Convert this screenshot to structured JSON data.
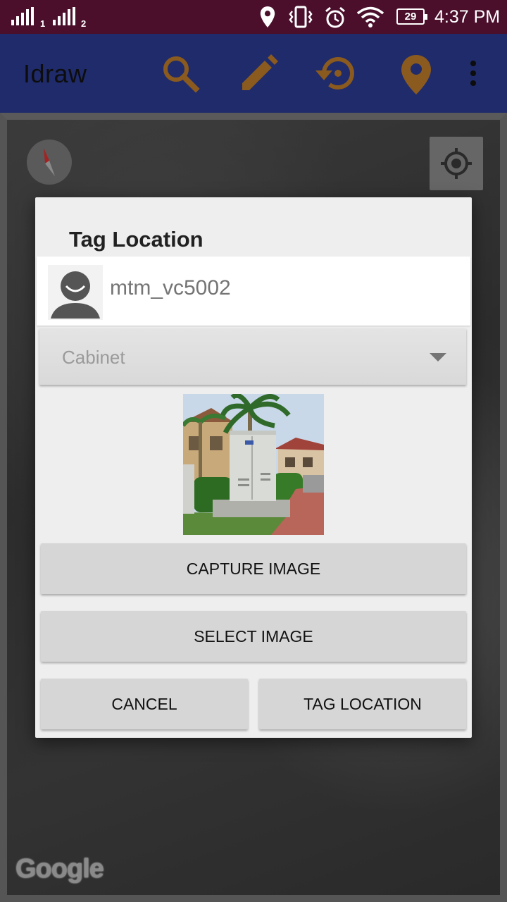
{
  "status_bar": {
    "sim1_label": "1",
    "sim2_label": "2",
    "battery": "29",
    "time": "4:37 PM",
    "icons": [
      "signal-sim1-icon",
      "signal-sim2-icon",
      "location-icon",
      "vibrate-icon",
      "alarm-icon",
      "wifi-icon",
      "battery-icon"
    ]
  },
  "app_bar": {
    "title": "Idraw",
    "accent_color": "#8a5a1e",
    "background": "#1f2b6b",
    "actions": [
      "search-icon",
      "edit-icon",
      "restore-icon",
      "place-icon",
      "more-vert-icon"
    ]
  },
  "map": {
    "attribution": "Google",
    "controls": [
      "compass-icon",
      "my-location-icon"
    ]
  },
  "dialog": {
    "title": "Tag Location",
    "user_placeholder": "mtm_vc5002",
    "category_selected": "Cabinet",
    "capture_label": "CAPTURE IMAGE",
    "select_label": "SELECT IMAGE",
    "cancel_label": "CANCEL",
    "tag_label": "TAG LOCATION"
  }
}
